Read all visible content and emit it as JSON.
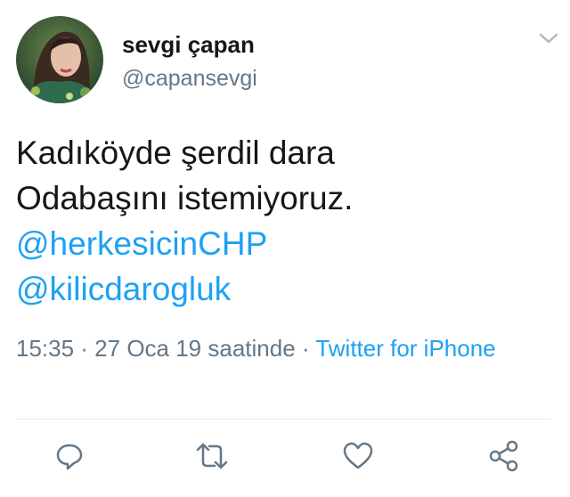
{
  "user": {
    "display_name": "sevgi çapan",
    "handle": "@capansevgi"
  },
  "tweet": {
    "line1": "Kadıköyde şerdil dara",
    "line2": "Odabaşını istemiyoruz.",
    "mention1": "@herkesicinCHP",
    "mention2": "@kilicdarogluk"
  },
  "meta": {
    "timestamp": "15:35 · 27 Oca 19 saatinde ·",
    "source": "Twitter for iPhone"
  },
  "icons": {
    "caret": "chevron-down-icon",
    "reply": "reply-icon",
    "retweet": "retweet-icon",
    "like": "heart-icon",
    "share": "share-icon"
  },
  "colors": {
    "text": "#14171a",
    "secondary": "#657786",
    "link": "#1da1f2"
  }
}
